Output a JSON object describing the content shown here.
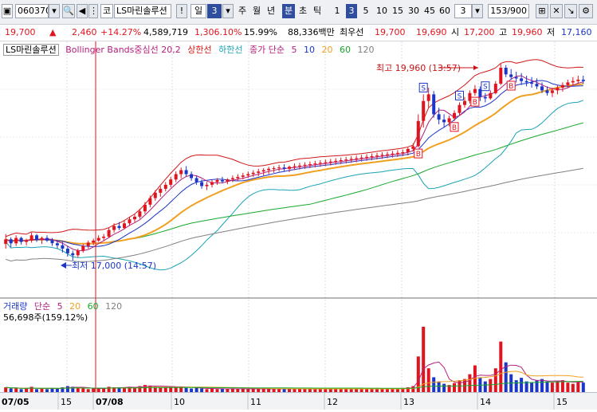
{
  "toolbar": {
    "code": "060370",
    "market_btn": "코",
    "stock_name": "LS마린솔루션",
    "alert_btn": "!",
    "period_unit": "일",
    "period_count": "3",
    "periods": [
      "주",
      "월",
      "년",
      "분",
      "초",
      "틱"
    ],
    "selected_period": "분",
    "minutes": [
      "1",
      "3",
      "5",
      "10",
      "15",
      "30",
      "45",
      "60"
    ],
    "selected_minute": "3",
    "minute_custom": "3",
    "range": "153/900"
  },
  "info": {
    "price": "19,700",
    "change": "2,460",
    "change_pct": "+14.27%",
    "volume": "4,589,719",
    "volume_ratio": "1,306.10%",
    "turnover": "15.99%",
    "amount": "88,336백만",
    "best_label": "최우선",
    "best_ask": "19,700",
    "best_bid": "19,690",
    "open_label": "시",
    "open": "17,200",
    "high_label": "고",
    "high": "19,960",
    "low_label": "저",
    "low": "17,160"
  },
  "legend": {
    "name": "LS마린솔루션",
    "bollinger": "Bollinger Bands중심선 20,2",
    "upper": "상한선",
    "lower": "하한선",
    "ma_label": "종가 단순",
    "ma5": "5",
    "ma10": "10",
    "ma20": "20",
    "ma60": "60",
    "ma120": "120"
  },
  "volume_legend": {
    "name": "거래량",
    "ma_label": "단순",
    "ma5": "5",
    "ma20": "20",
    "ma60": "60",
    "ma120": "120",
    "current": "56,698주(159.12%)"
  },
  "annotations": {
    "max": "최고 19,960 (13:57)",
    "min": "최저 17,000 (14:57)",
    "buy": "B",
    "sell": "S"
  },
  "colors": {
    "up": "#e0141e",
    "down": "#1b36c9",
    "ma5": "#b3207c",
    "ma10": "#1b36c9",
    "ma20": "#f0a020",
    "ma60": "#17a82a",
    "ma120": "#808080",
    "bb_upper": "#d01818",
    "bb_lower": "#1aa4b4",
    "vol_ma5": "#b3207c",
    "vol_ma20": "#f0a020",
    "vol_ma60": "#17a82a"
  },
  "chart_data": {
    "type": "candlestick",
    "interval": "3분",
    "x_labels": [
      "07/05",
      "15",
      "07/08",
      "10",
      "11",
      "12",
      "13",
      "14",
      "15"
    ],
    "y_range": [
      16700,
      20200
    ],
    "candles": [
      [
        17250,
        17400,
        17180,
        17320
      ],
      [
        17320,
        17350,
        17200,
        17260
      ],
      [
        17260,
        17380,
        17220,
        17340
      ],
      [
        17340,
        17360,
        17240,
        17280
      ],
      [
        17280,
        17330,
        17230,
        17300
      ],
      [
        17300,
        17420,
        17270,
        17380
      ],
      [
        17380,
        17400,
        17280,
        17310
      ],
      [
        17310,
        17360,
        17250,
        17340
      ],
      [
        17340,
        17380,
        17280,
        17300
      ],
      [
        17300,
        17340,
        17220,
        17260
      ],
      [
        17260,
        17300,
        17180,
        17230
      ],
      [
        17230,
        17280,
        17120,
        17180
      ],
      [
        17180,
        17220,
        17060,
        17110
      ],
      [
        17110,
        17150,
        17000,
        17080
      ],
      [
        17080,
        17180,
        17050,
        17150
      ],
      [
        17150,
        17250,
        17120,
        17220
      ],
      [
        17220,
        17300,
        17180,
        17270
      ],
      [
        17270,
        17330,
        17230,
        17300
      ],
      [
        17300,
        17380,
        17280,
        17340
      ],
      [
        17340,
        17400,
        17300,
        17360
      ],
      [
        17360,
        17500,
        17340,
        17460
      ],
      [
        17460,
        17560,
        17420,
        17520
      ],
      [
        17520,
        17580,
        17460,
        17490
      ],
      [
        17490,
        17600,
        17470,
        17560
      ],
      [
        17560,
        17660,
        17520,
        17620
      ],
      [
        17620,
        17700,
        17580,
        17660
      ],
      [
        17660,
        17780,
        17630,
        17740
      ],
      [
        17740,
        17880,
        17700,
        17840
      ],
      [
        17840,
        17980,
        17800,
        17940
      ],
      [
        17940,
        18060,
        17900,
        18020
      ],
      [
        18020,
        18120,
        17960,
        18080
      ],
      [
        18080,
        18180,
        18040,
        18140
      ],
      [
        18140,
        18260,
        18100,
        18220
      ],
      [
        18220,
        18340,
        18180,
        18300
      ],
      [
        18300,
        18400,
        18240,
        18360
      ],
      [
        18360,
        18420,
        18260,
        18300
      ],
      [
        18300,
        18340,
        18200,
        18240
      ],
      [
        18240,
        18280,
        18140,
        18180
      ],
      [
        18180,
        18220,
        18080,
        18120
      ],
      [
        18120,
        18180,
        18060,
        18140
      ],
      [
        18140,
        18220,
        18100,
        18180
      ],
      [
        18180,
        18240,
        18140,
        18210
      ],
      [
        18210,
        18260,
        18160,
        18190
      ],
      [
        18190,
        18240,
        18150,
        18220
      ],
      [
        18220,
        18280,
        18180,
        18240
      ],
      [
        18240,
        18300,
        18200,
        18260
      ],
      [
        18260,
        18320,
        18220,
        18280
      ],
      [
        18280,
        18340,
        18240,
        18300
      ],
      [
        18300,
        18360,
        18260,
        18320
      ],
      [
        18320,
        18380,
        18270,
        18340
      ],
      [
        18340,
        18390,
        18280,
        18360
      ],
      [
        18360,
        18410,
        18300,
        18380
      ],
      [
        18380,
        18420,
        18320,
        18390
      ],
      [
        18390,
        18440,
        18340,
        18400
      ],
      [
        18400,
        18450,
        18340,
        18380
      ],
      [
        18380,
        18430,
        18330,
        18410
      ],
      [
        18410,
        18460,
        18360,
        18420
      ],
      [
        18420,
        18470,
        18370,
        18430
      ],
      [
        18430,
        18480,
        18380,
        18440
      ],
      [
        18440,
        18490,
        18390,
        18450
      ],
      [
        18450,
        18500,
        18400,
        18460
      ],
      [
        18460,
        18510,
        18410,
        18470
      ],
      [
        18470,
        18520,
        18420,
        18480
      ],
      [
        18480,
        18530,
        18430,
        18490
      ],
      [
        18490,
        18540,
        18440,
        18500
      ],
      [
        18500,
        18550,
        18450,
        18510
      ],
      [
        18510,
        18560,
        18460,
        18520
      ],
      [
        18520,
        18570,
        18470,
        18530
      ],
      [
        18530,
        18580,
        18480,
        18540
      ],
      [
        18540,
        18590,
        18490,
        18550
      ],
      [
        18550,
        18600,
        18500,
        18560
      ],
      [
        18560,
        18610,
        18510,
        18570
      ],
      [
        18570,
        18620,
        18520,
        18580
      ],
      [
        18580,
        18630,
        18530,
        18590
      ],
      [
        18590,
        18640,
        18540,
        18600
      ],
      [
        18600,
        18650,
        18550,
        18610
      ],
      [
        18610,
        18660,
        18560,
        18620
      ],
      [
        18620,
        18670,
        18570,
        18630
      ],
      [
        18630,
        18700,
        18580,
        18680
      ],
      [
        18680,
        18760,
        18640,
        18720
      ],
      [
        18720,
        19200,
        18700,
        19100
      ],
      [
        19100,
        19500,
        19000,
        19400
      ],
      [
        19400,
        19600,
        19300,
        19500
      ],
      [
        19500,
        19550,
        19150,
        19200
      ],
      [
        19200,
        19300,
        19050,
        19120
      ],
      [
        19120,
        19200,
        19000,
        19080
      ],
      [
        19080,
        19180,
        19020,
        19140
      ],
      [
        19140,
        19260,
        19100,
        19220
      ],
      [
        19220,
        19380,
        19180,
        19340
      ],
      [
        19340,
        19460,
        19300,
        19400
      ],
      [
        19400,
        19560,
        19360,
        19520
      ],
      [
        19520,
        19640,
        19480,
        19580
      ],
      [
        19580,
        19620,
        19400,
        19460
      ],
      [
        19460,
        19520,
        19380,
        19440
      ],
      [
        19440,
        19560,
        19420,
        19520
      ],
      [
        19520,
        19700,
        19500,
        19660
      ],
      [
        19660,
        19960,
        19640,
        19900
      ],
      [
        19900,
        19940,
        19760,
        19800
      ],
      [
        19800,
        19880,
        19720,
        19760
      ],
      [
        19760,
        19840,
        19680,
        19740
      ],
      [
        19740,
        19820,
        19640,
        19700
      ],
      [
        19700,
        19780,
        19620,
        19680
      ],
      [
        19680,
        19760,
        19600,
        19660
      ],
      [
        19660,
        19740,
        19580,
        19620
      ],
      [
        19620,
        19680,
        19520,
        19560
      ],
      [
        19560,
        19620,
        19480,
        19520
      ],
      [
        19520,
        19600,
        19460,
        19560
      ],
      [
        19560,
        19640,
        19500,
        19600
      ],
      [
        19600,
        19680,
        19540,
        19640
      ],
      [
        19640,
        19720,
        19600,
        19680
      ],
      [
        19680,
        19760,
        19640,
        19700
      ],
      [
        19700,
        19780,
        19660,
        19720
      ],
      [
        19720,
        19780,
        19660,
        19700
      ]
    ],
    "volumes": [
      8,
      6,
      7,
      5,
      6,
      9,
      5,
      6,
      5,
      7,
      6,
      8,
      10,
      9,
      7,
      6,
      5,
      6,
      7,
      6,
      9,
      8,
      7,
      8,
      9,
      8,
      10,
      12,
      11,
      9,
      8,
      9,
      10,
      9,
      8,
      7,
      6,
      7,
      6,
      5,
      6,
      5,
      6,
      5,
      6,
      5,
      6,
      5,
      6,
      5,
      6,
      5,
      5,
      6,
      5,
      6,
      5,
      5,
      6,
      5,
      5,
      6,
      5,
      5,
      6,
      5,
      6,
      5,
      5,
      6,
      5,
      6,
      5,
      5,
      6,
      5,
      6,
      7,
      8,
      10,
      60,
      110,
      40,
      25,
      18,
      14,
      12,
      15,
      20,
      22,
      30,
      45,
      25,
      18,
      22,
      40,
      85,
      50,
      30,
      20,
      24,
      18,
      16,
      20,
      22,
      18,
      16,
      18,
      20,
      16,
      14,
      18,
      16
    ]
  }
}
